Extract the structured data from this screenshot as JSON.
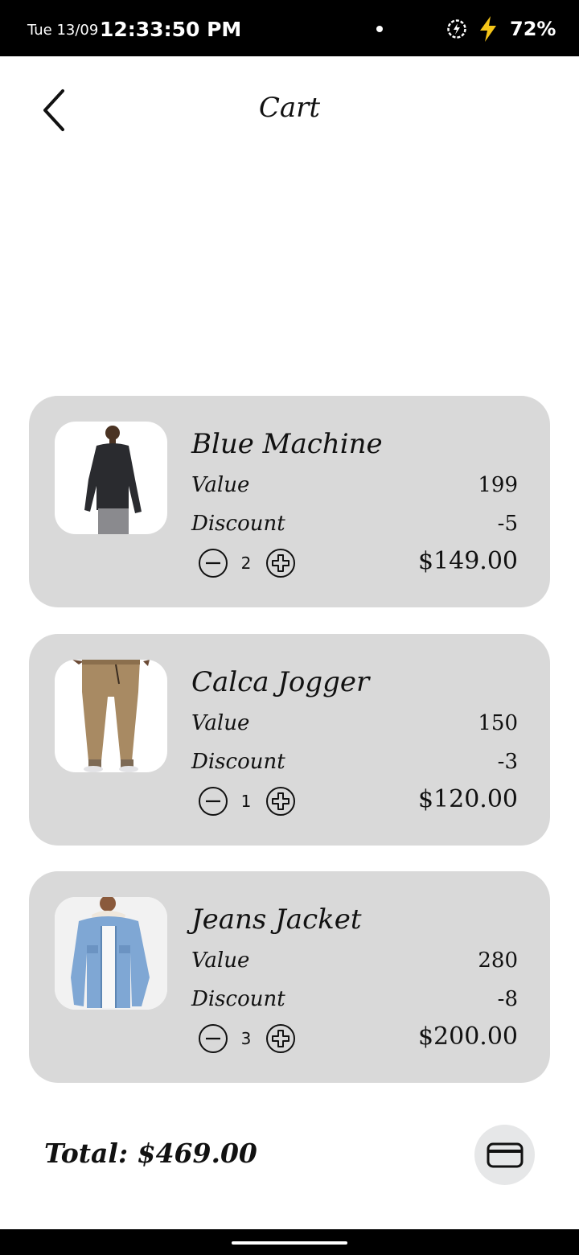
{
  "status_bar": {
    "date": "Tue 13/09",
    "time": "12:33:50 PM",
    "battery": "72%"
  },
  "header": {
    "title": "Cart"
  },
  "cart": {
    "items": [
      {
        "name": "Blue Machine",
        "value_label": "Value",
        "value": "199",
        "discount_label": "Discount",
        "discount": "-5",
        "quantity": "2",
        "price": "$149.00",
        "image": "man-in-dark-sweater-photo"
      },
      {
        "name": "Calca Jogger",
        "value_label": "Value",
        "value": "150",
        "discount_label": "Discount",
        "discount": "-3",
        "quantity": "1",
        "price": "$120.00",
        "image": "khaki-jogger-pants-photo"
      },
      {
        "name": "Jeans Jacket",
        "value_label": "Value",
        "value": "280",
        "discount_label": "Discount",
        "discount": "-8",
        "quantity": "3",
        "price": "$200.00",
        "image": "denim-jacket-photo"
      }
    ]
  },
  "footer": {
    "total": "Total: $469.00"
  },
  "icons": {
    "back": "chevron-left-icon",
    "minus": "minus-circle-icon",
    "plus": "plus-circle-icon",
    "payment": "credit-card-icon"
  },
  "colors": {
    "card_background": "#d9d9d9",
    "pay_button": "#e6e7e8",
    "status_bar": "#000000",
    "bolt": "#f5c518"
  }
}
